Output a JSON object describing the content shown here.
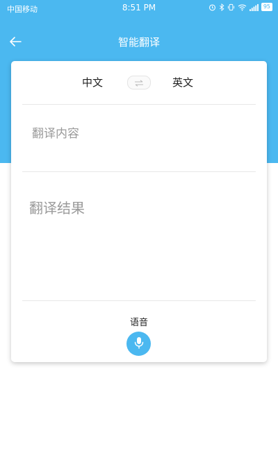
{
  "status_bar": {
    "carrier": "中国移动",
    "time": "8:51 PM",
    "battery": "95"
  },
  "header": {
    "title": "智能翻译",
    "back_icon": "arrow-left-icon"
  },
  "languages": {
    "source": "中文",
    "target": "英文",
    "swap_icon": "swap-arrows-icon"
  },
  "input": {
    "value": "",
    "placeholder": "翻译内容"
  },
  "result": {
    "text": "翻译结果"
  },
  "voice": {
    "label": "语音",
    "icon": "microphone-icon"
  },
  "colors": {
    "accent": "#4bb8f0",
    "background": "#ffffff"
  }
}
